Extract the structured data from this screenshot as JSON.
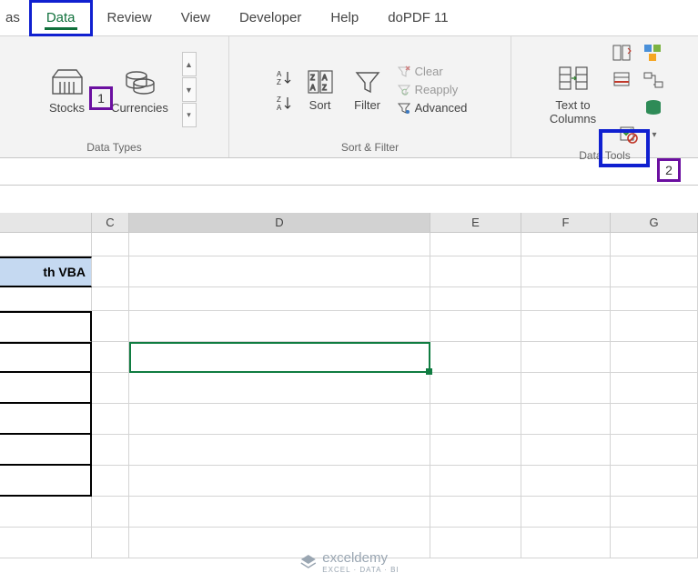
{
  "tabs": {
    "formulas_partial": "as",
    "data": "Data",
    "review": "Review",
    "view": "View",
    "developer": "Developer",
    "help": "Help",
    "dopdf": "doPDF 11"
  },
  "ribbon": {
    "data_types": {
      "stocks": "Stocks",
      "currencies": "Currencies",
      "label": "Data Types"
    },
    "sort_filter": {
      "sort": "Sort",
      "filter": "Filter",
      "clear": "Clear",
      "reapply": "Reapply",
      "advanced": "Advanced",
      "label": "Sort & Filter"
    },
    "data_tools": {
      "text_to_columns": "Text to\nColumns",
      "label": "Data Tools"
    }
  },
  "callouts": {
    "one": "1",
    "two": "2"
  },
  "columns": {
    "c": "C",
    "d": "D",
    "e": "E",
    "f": "F",
    "g": "G"
  },
  "cells": {
    "header_partial": "th VBA"
  },
  "watermark": {
    "brand": "exceldemy",
    "sub": "EXCEL · DATA · BI"
  }
}
